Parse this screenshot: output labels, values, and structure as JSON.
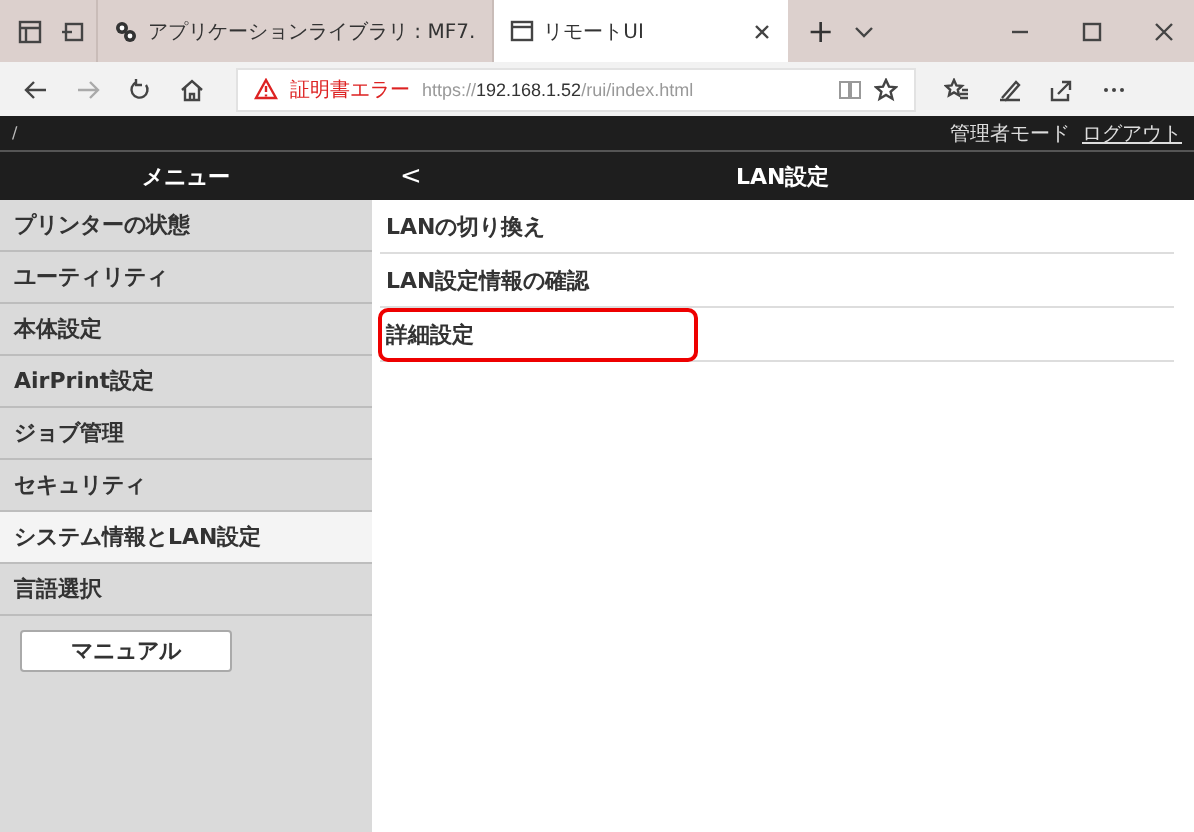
{
  "browser": {
    "tabs": [
      {
        "title": "アプリケーションライブラリ : MF7.",
        "selected": false
      },
      {
        "title": "リモートUI",
        "selected": true
      }
    ],
    "new_tab": "+",
    "address": {
      "warning": "証明書エラー",
      "url": "https://**192.168.1.52**/rui/index.html"
    }
  },
  "top_bar": {
    "path": "/",
    "mode": "管理者モード",
    "logout": "ログアウト"
  },
  "sidebar": {
    "title": "メニュー",
    "items": [
      {
        "label": "プリンターの状態",
        "selected": false
      },
      {
        "label": "ユーティリティ",
        "selected": false
      },
      {
        "label": "本体設定",
        "selected": false
      },
      {
        "label": "AirPrint設定",
        "selected": false
      },
      {
        "label": "ジョブ管理",
        "selected": false
      },
      {
        "label": "セキュリティ",
        "selected": false
      },
      {
        "label": "システム情報とLAN設定",
        "selected": true
      },
      {
        "label": "言語選択",
        "selected": false
      }
    ],
    "manual_button": "マニュアル"
  },
  "content": {
    "back": "<",
    "title": "LAN設定",
    "items": [
      {
        "label": "LANの切り換え",
        "highlighted": false
      },
      {
        "label": "LAN設定情報の確認",
        "highlighted": false
      },
      {
        "label": "詳細設定",
        "highlighted": true
      }
    ]
  }
}
